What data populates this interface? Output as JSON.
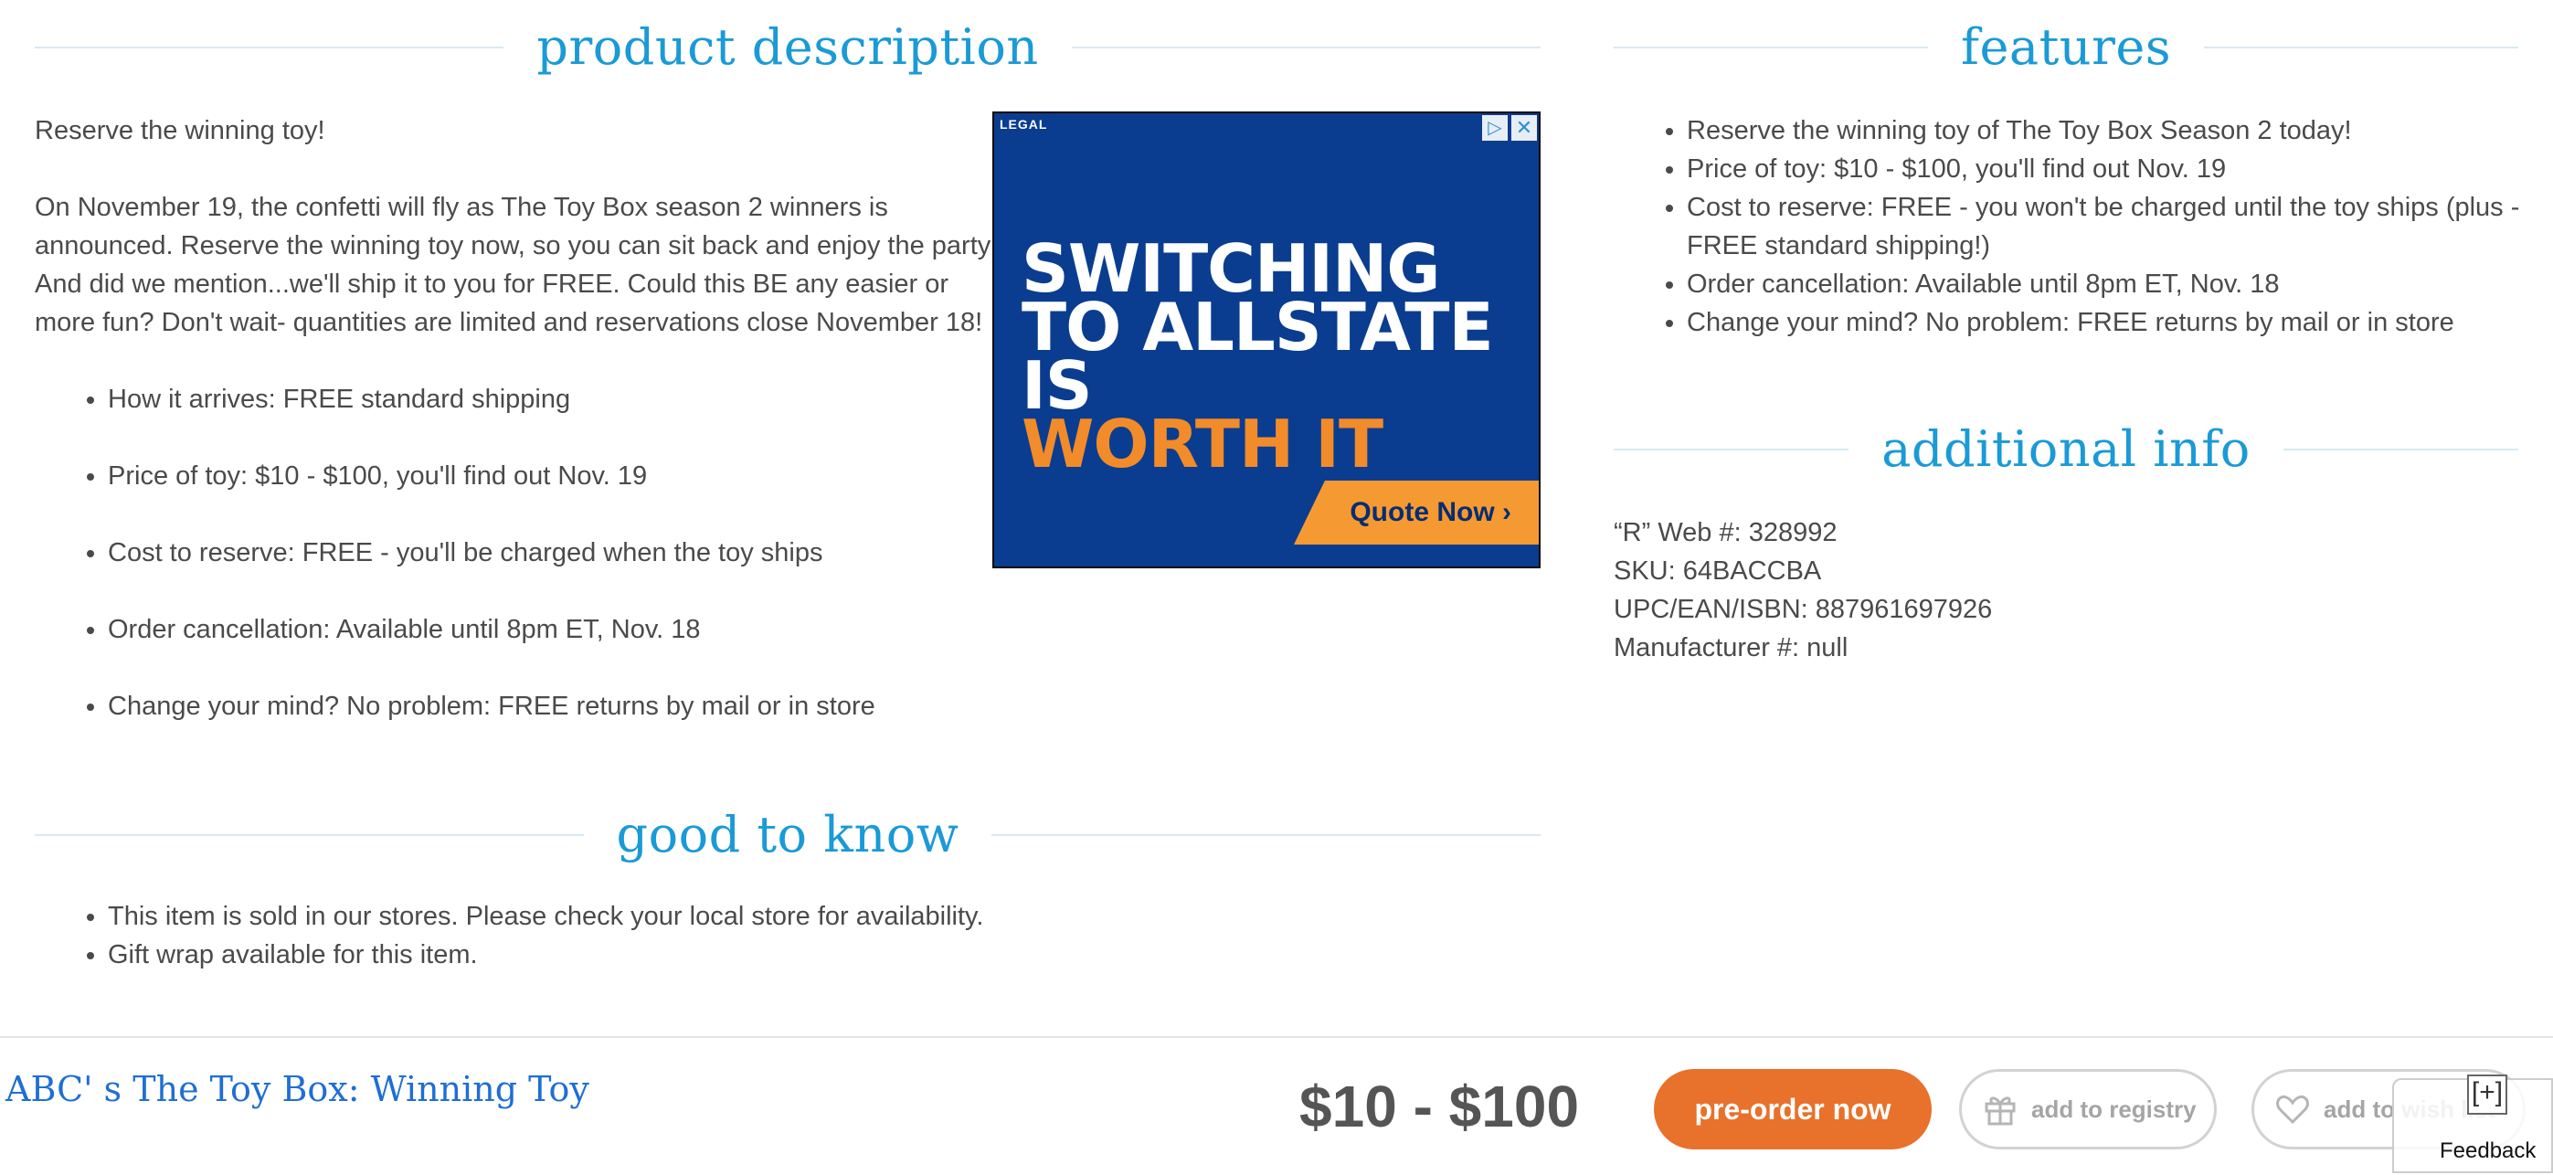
{
  "product_description": {
    "heading": "product description",
    "intro": "Reserve the winning toy!",
    "body_lines": [
      "On November 19, the confetti will fly as The Toy Box season 2 winners is",
      "announced. Reserve the winning toy now, so you can sit back and enjoy the party!",
      "And did we mention...we'll ship it to you for FREE. Could this BE any easier or",
      "more fun? Don't wait- quantities are limited and reservations close November 18!"
    ],
    "bullets": [
      "How it arrives: FREE standard shipping",
      "Price of toy: $10 - $100, you'll find out Nov. 19",
      "Cost to reserve: FREE - you'll be charged when the toy ships",
      "Order cancellation: Available until 8pm ET, Nov. 18",
      "Change your mind? No problem: FREE returns by mail or in store"
    ]
  },
  "ad": {
    "legal": "LEGAL",
    "adchoices_icon": "adchoices-icon",
    "close_icon": "close-icon",
    "headline_1": "SWITCHING",
    "headline_2": "TO ALLSTATE IS",
    "headline_3": "WORTH IT",
    "cta": "Quote Now ›",
    "colors": {
      "background": "#0a3d8f",
      "accent": "#f28b2a",
      "button": "#f59a33"
    }
  },
  "features": {
    "heading": "features",
    "bullets": [
      "Reserve the winning toy of The Toy Box Season 2 today!",
      "Price of toy: $10 - $100, you'll find out Nov. 19",
      "Cost to reserve: FREE - you won't be charged until the toy ships (plus -",
      "FREE standard shipping!)",
      "Order cancellation: Available until 8pm ET, Nov. 18",
      "Change your mind? No problem: FREE returns by mail or in store"
    ]
  },
  "additional_info": {
    "heading": "additional info",
    "web_number": "“R” Web #: 328992",
    "sku": "SKU: 64BACCBA",
    "upc": "UPC/EAN/ISBN: 887961697926",
    "manufacturer": "Manufacturer #: null"
  },
  "good_to_know": {
    "heading": "good to know",
    "bullets": [
      "This item is sold in our stores. Please check your local store for availability.",
      "Gift wrap available for this item."
    ]
  },
  "bottom_bar": {
    "product_title": "ABC' s The Toy Box: Winning Toy",
    "price": "$10 - $100",
    "preorder_label": "pre-order now",
    "registry_label": "add to registry",
    "registry_icon": "gift-icon",
    "wishlist_label": "add to wish list",
    "wishlist_icon": "heart-icon",
    "expand_label": "[+]",
    "feedback_label": "Feedback"
  },
  "colors": {
    "heading": "#1a9ad6",
    "rule": "#d6eaf5",
    "title_link": "#1f6ed4",
    "preorder": "#e8712b"
  }
}
